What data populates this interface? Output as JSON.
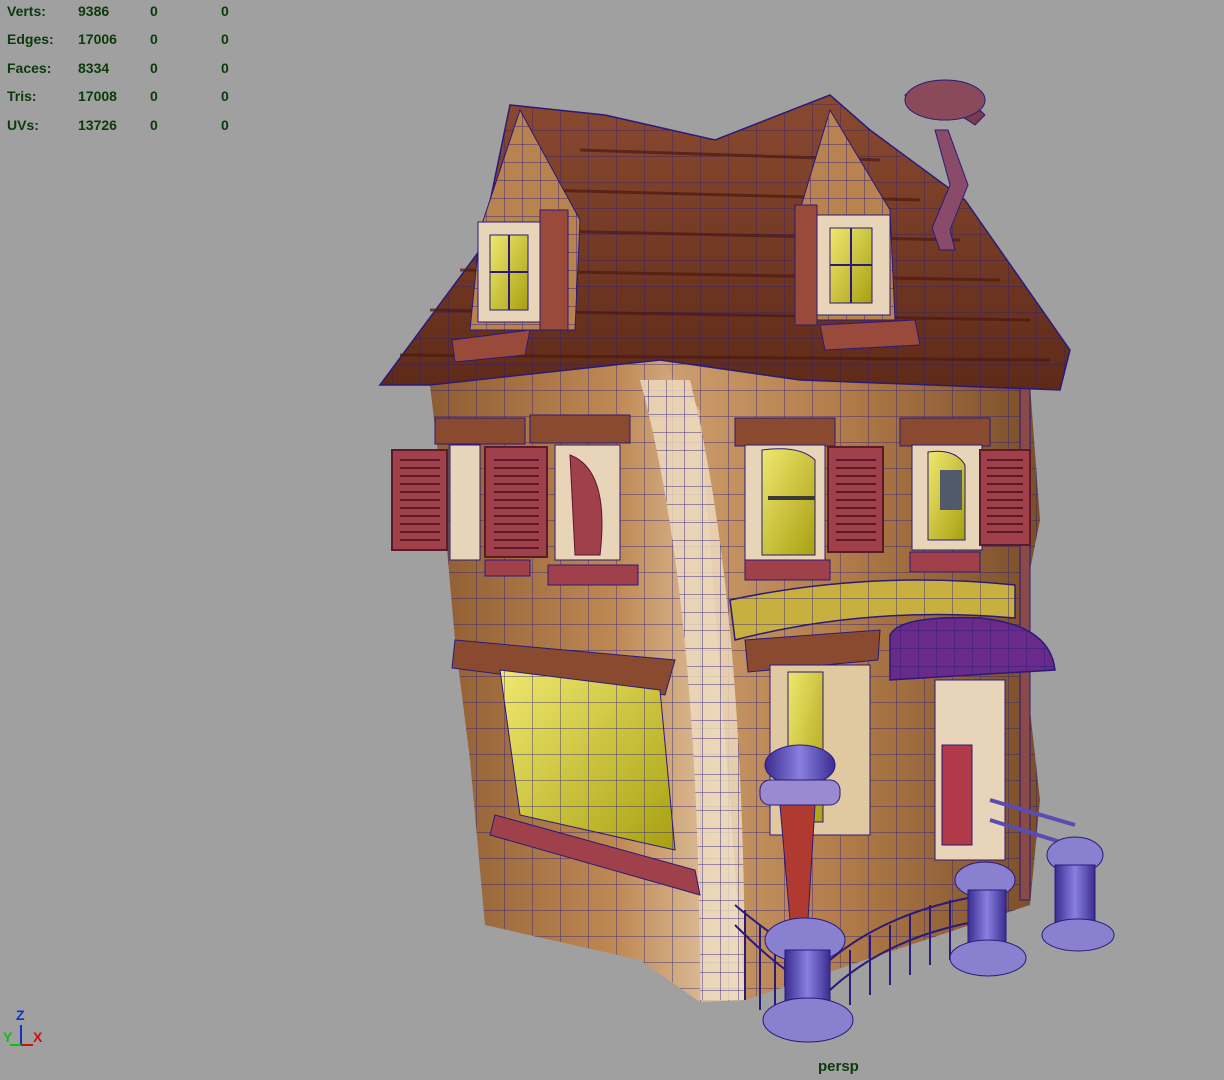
{
  "hud": {
    "rows": [
      {
        "label": "Verts:",
        "v1": "9386",
        "v2": "0",
        "v3": "0"
      },
      {
        "label": "Edges:",
        "v1": "17006",
        "v2": "0",
        "v3": "0"
      },
      {
        "label": "Faces:",
        "v1": "8334",
        "v2": "0",
        "v3": "0"
      },
      {
        "label": "Tris:",
        "v1": "17008",
        "v2": "0",
        "v3": "0"
      },
      {
        "label": "UVs:",
        "v1": "13726",
        "v2": "0",
        "v3": "0"
      }
    ]
  },
  "camera": "persp",
  "axis": {
    "z": "Z",
    "y": "Y",
    "x": "X"
  },
  "colors": {
    "background": "#a0a0a0",
    "hud_text": "#0b3a0b",
    "wireframe": "#2a1a7a",
    "wall": "#b8834f",
    "roof": "#7a3a22",
    "window_glass": "#d8d020",
    "shutter": "#a0404a",
    "railing": "#5a4cb0"
  }
}
